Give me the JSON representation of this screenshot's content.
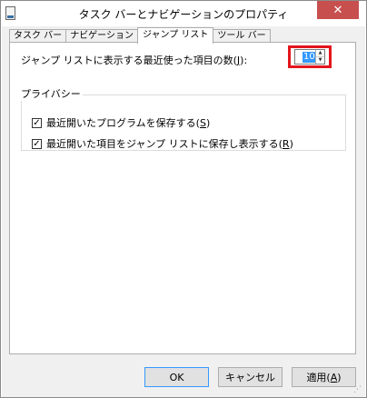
{
  "window": {
    "title": "タスク バーとナビゲーションのプロパティ",
    "close_glyph": "✕",
    "close_color": "#c7504f"
  },
  "tabs": [
    {
      "label": "タスク バー",
      "active": false
    },
    {
      "label": "ナビゲーション",
      "active": false
    },
    {
      "label": "ジャンプ リスト",
      "active": true
    },
    {
      "label": "ツール バー",
      "active": false
    }
  ],
  "jumplist": {
    "count_label_prefix": "ジャンプ リストに表示する最近使った項目の数(",
    "count_label_key": "J",
    "count_label_suffix": "):",
    "count_value": "10",
    "highlight_color": "#e3161c"
  },
  "privacy": {
    "group_label": "プライバシー",
    "options": [
      {
        "prefix": "最近開いたプログラムを保存する(",
        "key": "S",
        "suffix": ")",
        "checked": true
      },
      {
        "prefix": "最近開いた項目をジャンプ リストに保存し表示する(",
        "key": "R",
        "suffix": ")",
        "checked": true
      }
    ]
  },
  "buttons": {
    "ok": "OK",
    "cancel": "キャンセル",
    "apply_prefix": "適用(",
    "apply_key": "A",
    "apply_suffix": ")"
  },
  "icons": {
    "app": "taskbar-properties-icon",
    "check_glyph": "✓",
    "spin_up_glyph": "▲",
    "spin_down_glyph": "▼"
  }
}
